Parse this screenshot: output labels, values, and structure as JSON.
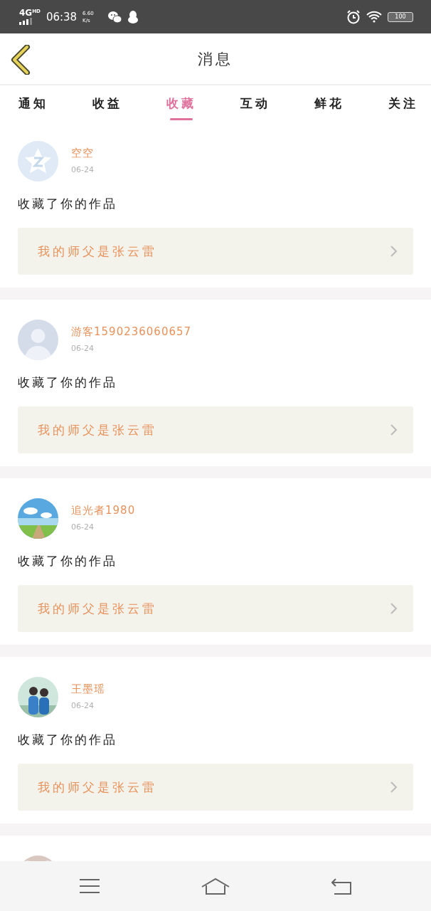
{
  "status_bar": {
    "network": "4G",
    "network_badge": "HD",
    "time": "06:38",
    "speed": "6.60",
    "speed_unit": "K/s",
    "battery": "100"
  },
  "header": {
    "title": "消息"
  },
  "tabs": [
    {
      "label": "通知",
      "selected": false
    },
    {
      "label": "收益",
      "selected": false
    },
    {
      "label": "收藏",
      "selected": true
    },
    {
      "label": "互动",
      "selected": false
    },
    {
      "label": "鲜花",
      "selected": false
    },
    {
      "label": "关注",
      "selected": false
    }
  ],
  "messages": [
    {
      "avatar": {
        "kind": "star"
      },
      "name": "空空",
      "date": "06-24",
      "action": "收藏了你的作品",
      "work": "我的师父是张云雷"
    },
    {
      "avatar": {
        "kind": "silhouette"
      },
      "name": "游客1590236060657",
      "date": "06-24",
      "action": "收藏了你的作品",
      "work": "我的师父是张云雷"
    },
    {
      "avatar": {
        "kind": "picture"
      },
      "name": "追光者1980",
      "date": "06-24",
      "action": "收藏了你的作品",
      "work": "我的师父是张云雷"
    },
    {
      "avatar": {
        "kind": "picture"
      },
      "name": "王墨瑶",
      "date": "06-24",
      "action": "收藏了你的作品",
      "work": "我的师父是张云雷"
    },
    {
      "avatar": {
        "kind": "picture"
      }
    }
  ]
}
